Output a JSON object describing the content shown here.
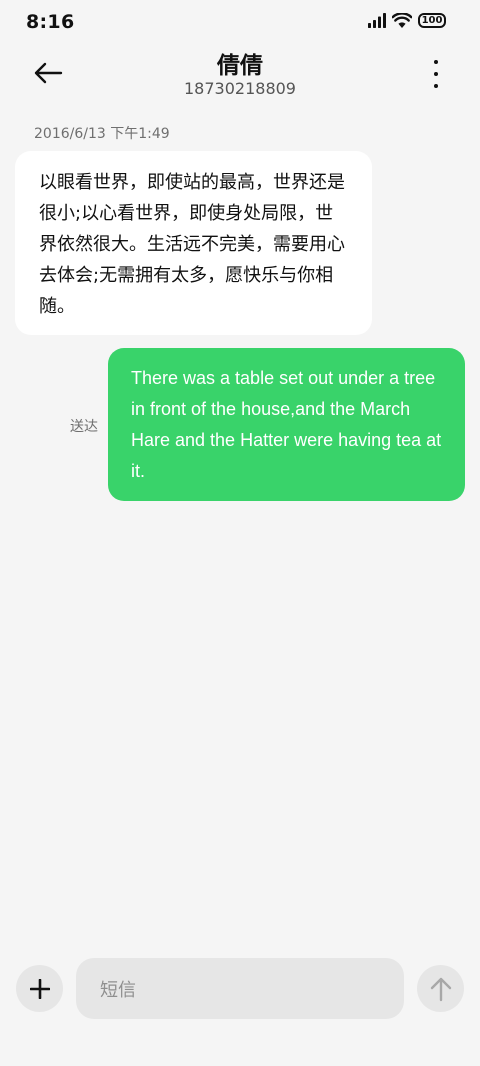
{
  "status_bar": {
    "time": "8:16",
    "battery": "100",
    "icons": [
      "signal-icon",
      "wifi-icon",
      "battery-icon"
    ]
  },
  "header": {
    "contact_name": "倩倩",
    "contact_number": "18730218809",
    "icons": [
      "back-arrow-icon",
      "more-vertical-icon"
    ]
  },
  "conversation": {
    "timestamp": "2016/6/13 下午1:49",
    "incoming_message": "以眼看世界，即使站的最高，世界还是很小;以心看世界，即使身处局限，世界依然很大。生活远不完美，需要用心去体会;无需拥有太多，愿快乐与你相随。",
    "outgoing_message": "There was a table set out under a tree in front of the house,and the March Hare and the Hatter were having tea at it.",
    "outgoing_status": "送达"
  },
  "composer": {
    "placeholder": "短信",
    "icons": [
      "plus-icon",
      "send-arrow-icon"
    ]
  },
  "colors": {
    "background": "#f5f5f5",
    "incoming_bubble": "#ffffff",
    "outgoing_bubble": "#39d36a",
    "composer_fill": "#e6e6e6"
  }
}
